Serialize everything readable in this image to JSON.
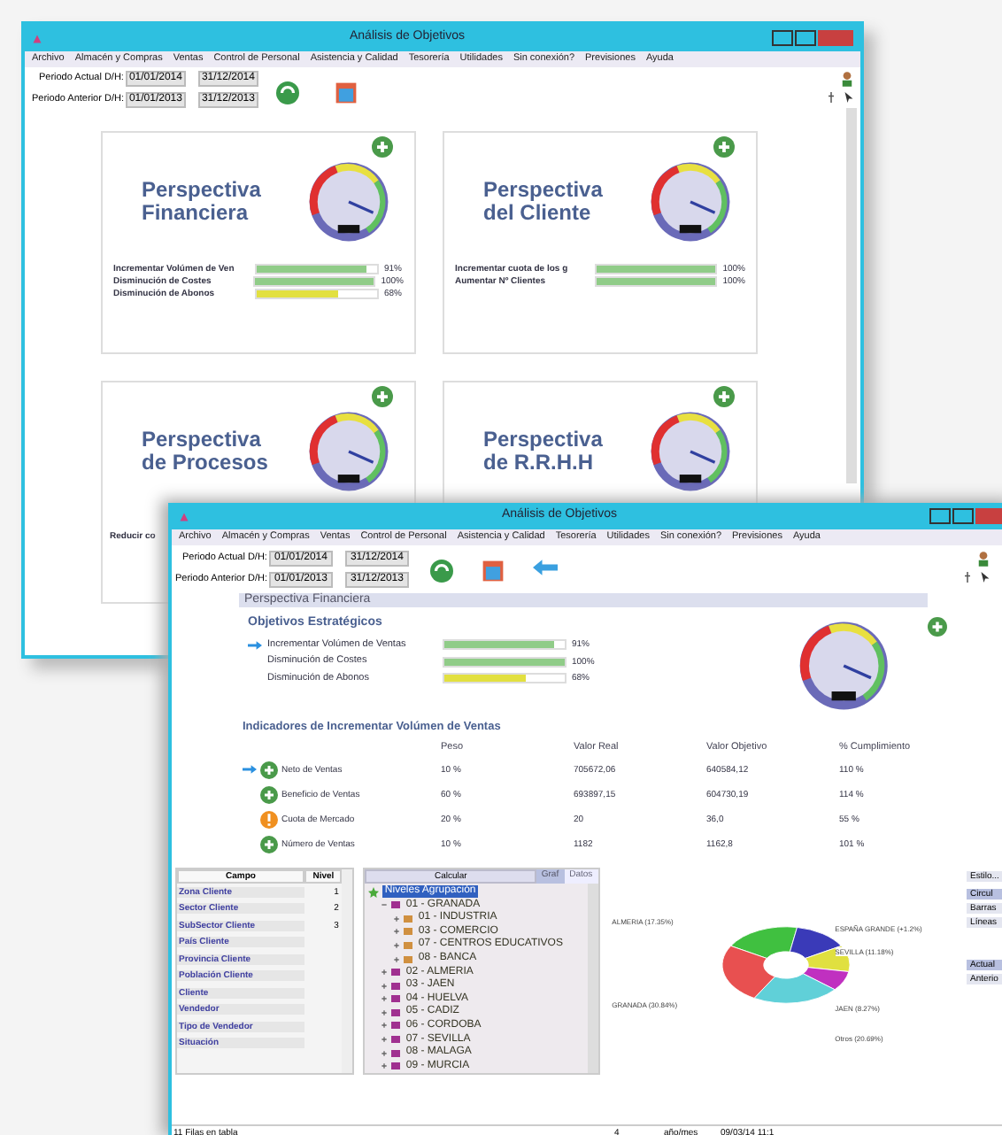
{
  "back_window": {
    "title": "Análisis de Objetivos",
    "menu": [
      "Archivo",
      "Almacén y Compras",
      "Ventas",
      "Control de Personal",
      "Asistencia y Calidad",
      "Tesorería",
      "Utilidades",
      "Sin conexión?",
      "Previsiones",
      "Ayuda"
    ],
    "periods": [
      {
        "label": "Periodo Actual D/H:",
        "from": "01/01/2014",
        "to": "31/12/2014"
      },
      {
        "label": "Periodo Anterior D/H:",
        "from": "01/01/2013",
        "to": "31/12/2013"
      }
    ],
    "cards": [
      {
        "title": "Perspectiva Financiera",
        "objectives": [
          {
            "label": "Incrementar Volúmen de Ven",
            "level": 0.91,
            "reading": "91%",
            "color": "#90cc88"
          },
          {
            "label": "Disminución de Costes",
            "level": 1,
            "reading": "100%",
            "color": "#90cc88"
          },
          {
            "label": "Disminución de Abonos",
            "level": 0.68,
            "reading": "68%",
            "color": "#e2e040"
          }
        ]
      },
      {
        "title": "Perspectiva del Cliente",
        "objectives": [
          {
            "label": "Incrementar cuota de los g",
            "level": 1,
            "reading": "100%",
            "color": "#90cc88"
          },
          {
            "label": "Aumentar  Nº Clientes",
            "level": 1,
            "reading": "100%",
            "color": "#90cc88"
          }
        ]
      },
      {
        "title": "Perspectiva de Procesos"
      },
      {
        "title": "Perspectiva de R.R.H.H"
      }
    ],
    "clipped_text": "Reducir co"
  },
  "front_window": {
    "title": "Análisis de Objetivos",
    "menu": [
      "Archivo",
      "Almacén y Compras",
      "Ventas",
      "Control de Personal",
      "Asistencia y Calidad",
      "Tesorería",
      "Utilidades",
      "Sin conexión?",
      "Previsiones",
      "Ayuda"
    ],
    "periods": [
      {
        "label": "Periodo Actual D/H:",
        "from": "01/01/2014",
        "to": "31/12/2014"
      },
      {
        "label": "Periodo Anterior D/H:",
        "from": "01/01/2013",
        "to": "31/12/2013"
      }
    ],
    "section_title": "Perspectiva Financiera",
    "objectives_title": "Objetivos Estratégicos",
    "objectives": [
      {
        "label": "Incrementar Volúmen de Ventas",
        "level": 0.91,
        "reading": "91%",
        "color": "#90cc88",
        "current": true
      },
      {
        "label": "Disminución de Costes",
        "level": 1,
        "reading": "100%",
        "color": "#90cc88",
        "current": false
      },
      {
        "label": "Disminución de Abonos",
        "level": 0.68,
        "reading": "68%",
        "color": "#e2e040",
        "current": false
      }
    ],
    "indicators_title": "Indicadores de Incrementar Volúmen de Ventas",
    "columns": [
      "Peso",
      "Valor Real",
      "Valor Objetivo",
      "% Cumplimiento"
    ],
    "indicators": [
      {
        "kind": "ok",
        "current": true,
        "label": "Neto de Ventas",
        "cells": [
          "10 %",
          "705672,06",
          "640584,12",
          "110 %"
        ]
      },
      {
        "kind": "ok",
        "current": false,
        "label": "Beneficio de Ventas",
        "cells": [
          "60 %",
          "693897,15",
          "604730,19",
          "114 %"
        ]
      },
      {
        "kind": "warning",
        "current": false,
        "label": "Cuota de Mercado",
        "cells": [
          "20 %",
          "20",
          "36,0",
          "55 %"
        ]
      },
      {
        "kind": "ok",
        "current": false,
        "label": "Número de Ventas",
        "cells": [
          "10 %",
          "1182",
          "1162,8",
          "101 %"
        ]
      }
    ],
    "fields": {
      "columns": [
        "Campo",
        "Nivel"
      ],
      "rows": [
        {
          "name": "Zona Cliente",
          "level_text": "1"
        },
        {
          "name": "Sector Cliente",
          "level_text": "2"
        },
        {
          "name": "SubSector Cliente",
          "level_text": "3"
        },
        {
          "name": "País Cliente"
        },
        {
          "name": "Provincia Cliente"
        },
        {
          "name": "Población Cliente"
        },
        {
          "name": "Cliente"
        },
        {
          "name": "Vendedor"
        },
        {
          "name": "Tipo de Vendedor"
        },
        {
          "name": "Situación"
        }
      ]
    },
    "tree_header": "Calcular",
    "tabs": [
      {
        "label": "Graf",
        "selected": true
      },
      {
        "label": "Datos",
        "selected": false
      }
    ],
    "tree": [
      {
        "label": "Niveles Agrupación",
        "selected": true,
        "children": [
          {
            "label": "01 - GRANADA",
            "selected": false,
            "expanded": true,
            "children": [
              {
                "label": "01 - INDUSTRIA",
                "selected": false,
                "expanded": false
              },
              {
                "label": "03 - COMERCIO",
                "selected": false,
                "expanded": false
              },
              {
                "label": "07 - CENTROS EDUCATIVOS",
                "selected": false,
                "expanded": false
              },
              {
                "label": "08 - BANCA",
                "selected": false,
                "expanded": false
              }
            ]
          },
          {
            "label": "02 - ALMERIA",
            "selected": false,
            "expanded": false
          },
          {
            "label": "03 - JAEN",
            "selected": false,
            "expanded": false
          },
          {
            "label": "04 - HUELVA",
            "selected": false,
            "expanded": false
          },
          {
            "label": "05 - CADIZ",
            "selected": false,
            "expanded": false
          },
          {
            "label": "06 - CORDOBA",
            "selected": false,
            "expanded": false
          },
          {
            "label": "07 - SEVILLA",
            "selected": false,
            "expanded": false
          },
          {
            "label": "08 - MALAGA",
            "selected": false,
            "expanded": false
          },
          {
            "label": "09 - MURCIA",
            "selected": false,
            "expanded": false
          }
        ]
      }
    ],
    "pie_labels": [
      "ALMERIA (17.35%)",
      "ESPAÑA GRANDE (+1.2%)",
      "SEVILLA (11.18%)",
      "GRANADA (30.84%)",
      "JAEN (8.27%)",
      "Otros (20.69%)"
    ],
    "side_panel": [
      "Estilo...",
      "Circul",
      "Barras",
      "Líneas",
      "Actual",
      "Anterio"
    ],
    "status_bar": [
      "11 Filas en tabla",
      "4",
      "año/mes",
      "09/03/14 11:1"
    ]
  }
}
